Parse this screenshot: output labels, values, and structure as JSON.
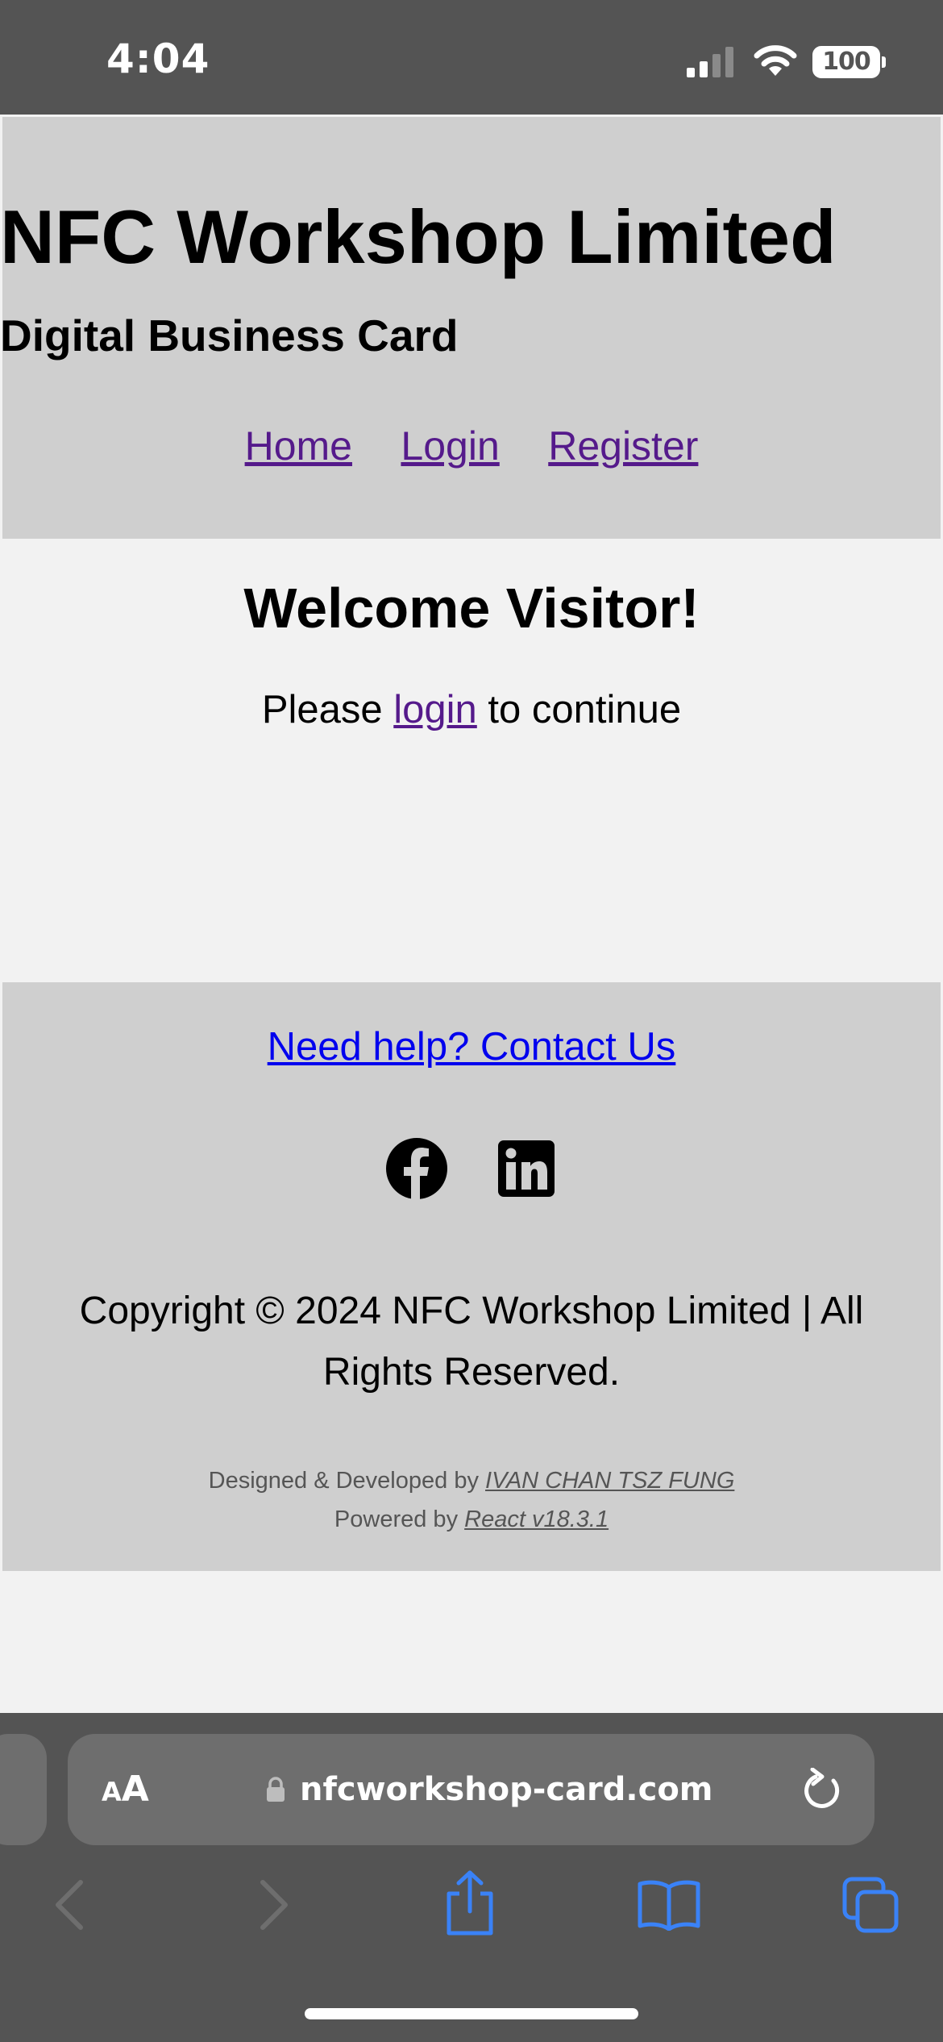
{
  "status_bar": {
    "time": "4:04",
    "battery_level": "100",
    "icons": [
      "signal-icon",
      "wifi-icon",
      "battery-icon"
    ]
  },
  "header": {
    "title": "NFC Workshop Limited",
    "subtitle": "Digital Business Card",
    "nav": [
      {
        "label": "Home"
      },
      {
        "label": "Login"
      },
      {
        "label": "Register"
      }
    ]
  },
  "main": {
    "heading": "Welcome Visitor!",
    "prompt_before": "Please ",
    "prompt_link": "login",
    "prompt_after": " to continue"
  },
  "footer": {
    "contact_link": "Need help? Contact Us",
    "social_icons": [
      "facebook-icon",
      "linkedin-icon"
    ],
    "copyright": "Copyright © 2024 NFC Workshop Limited | All Rights Reserved.",
    "designed_prefix": "Designed & Developed by ",
    "designer": "IVAN CHAN TSZ FUNG",
    "powered_prefix": "Powered by ",
    "powered_link": "React v18.3.1"
  },
  "browser": {
    "text_size_small": "A",
    "text_size_big": "A",
    "url": "nfcworkshop-card.com",
    "toolbar_icons": [
      "back-icon",
      "forward-icon",
      "share-icon",
      "bookmarks-icon",
      "tabs-icon"
    ]
  },
  "colors": {
    "chrome": "#545454",
    "panel": "#cfcfcf",
    "page": "#f2f2f2",
    "visited_link": "#551a8b",
    "link": "#0000ee",
    "ios_blue": "#3a82f7"
  }
}
